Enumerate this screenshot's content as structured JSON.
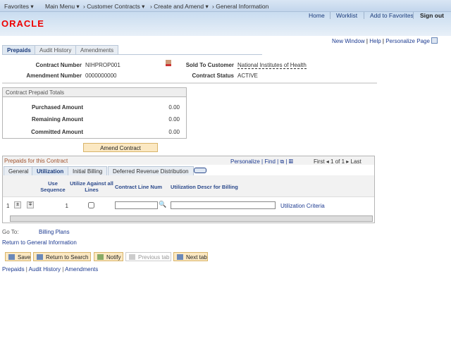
{
  "nav": {
    "favorites": "Favorites",
    "main_menu": "Main Menu",
    "crumbs": [
      "Customer Contracts",
      "Create and Amend",
      "General Information"
    ]
  },
  "header": {
    "logo": "ORACLE",
    "links": [
      "Home",
      "Worklist",
      "Add to Favorites",
      "Sign out"
    ]
  },
  "pagebar": {
    "new_window": "New Window",
    "help": "Help",
    "personalize": "Personalize Page"
  },
  "tabs": [
    "Prepaids",
    "Audit History",
    "Amendments"
  ],
  "fields": {
    "contract_number_label": "Contract Number",
    "contract_number": "NIHPROP001",
    "amendment_label": "Amendment Number",
    "amendment": "0000000000",
    "sold_to_label": "Sold To Customer",
    "sold_to": "National Institutes of Health",
    "status_label": "Contract Status",
    "status": "ACTIVE"
  },
  "totals": {
    "title": "Contract Prepaid Totals",
    "rows": [
      {
        "label": "Purchased Amount",
        "value": "0.00"
      },
      {
        "label": "Remaining Amount",
        "value": "0.00"
      },
      {
        "label": "Committed Amount",
        "value": "0.00"
      }
    ]
  },
  "amend_button": "Amend Contract",
  "grid": {
    "title": "Prepaids for this Contract",
    "personalize": "Personalize",
    "find": "Find",
    "first": "First",
    "count": "1 of 1",
    "last": "Last",
    "tabs": [
      "General",
      "Utilization",
      "Initial Billing",
      "Deferred Revenue Distribution"
    ],
    "columns": [
      "Use Sequence",
      "Utilize Against all Lines",
      "Contract Line Num",
      "Utilization Descr for Billing"
    ],
    "row": {
      "num": "1",
      "seq": "1",
      "checked": false,
      "line_num": "",
      "descr": "",
      "link": "Utilization Criteria"
    }
  },
  "goto": {
    "label": "Go To:",
    "link": "Billing Plans"
  },
  "return_link": "Return to General Information",
  "toolbar": {
    "save": "Save",
    "return": "Return to Search",
    "notify": "Notify",
    "prev": "Previous tab",
    "next": "Next tab"
  },
  "footer_links": [
    "Prepaids",
    "Audit History",
    "Amendments"
  ]
}
